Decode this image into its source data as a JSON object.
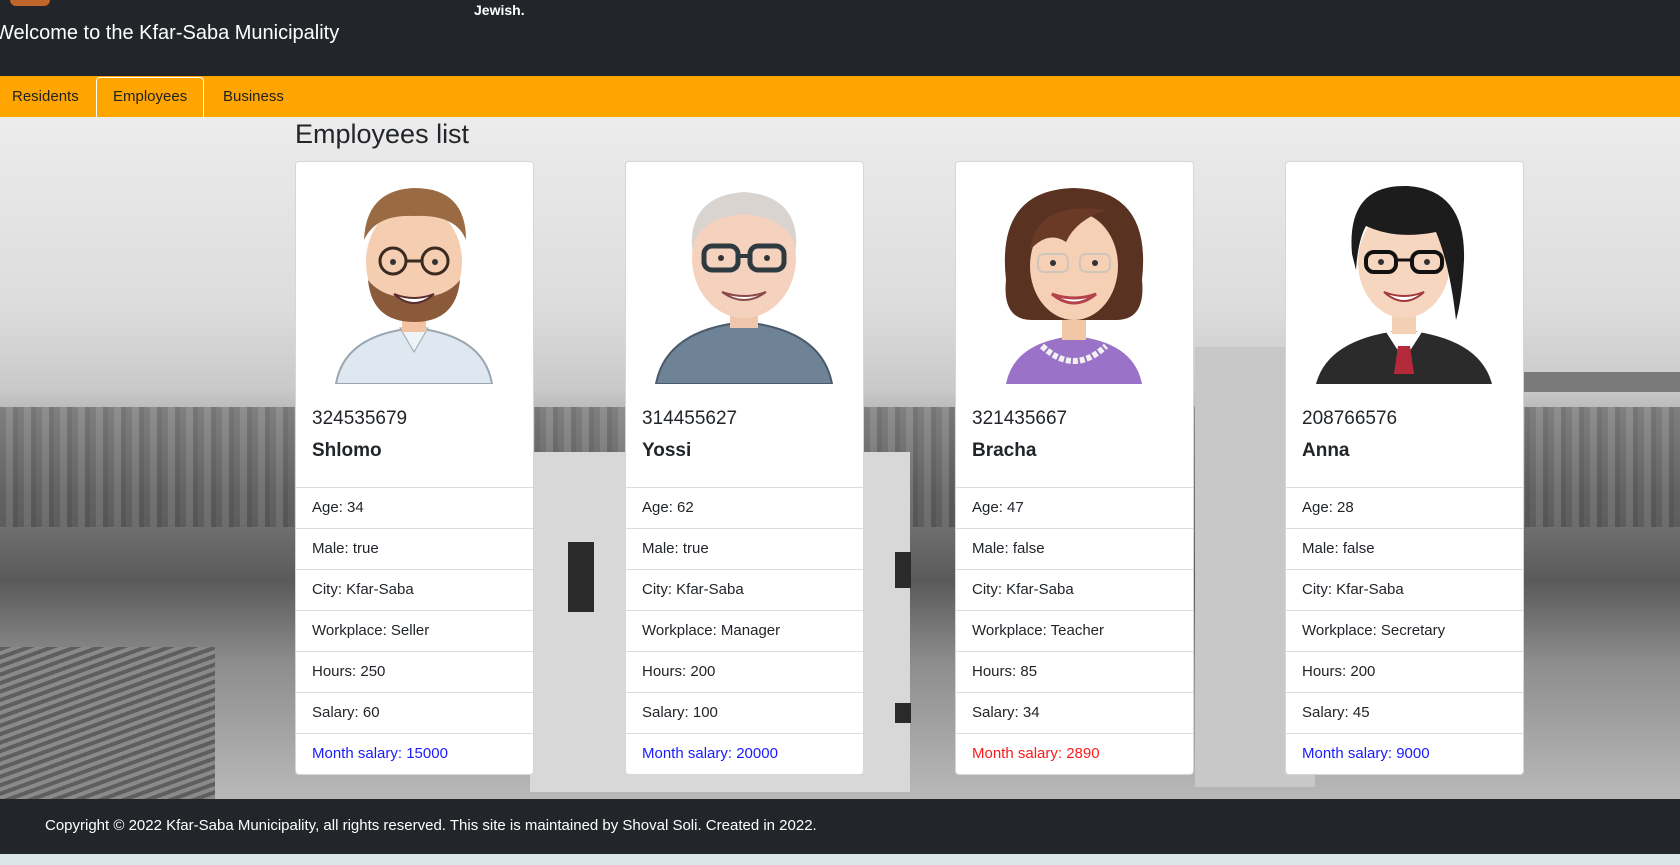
{
  "header": {
    "tagline": "Jewish.",
    "welcome": "Welcome to the Kfar-Saba Municipality"
  },
  "nav": {
    "tabs": [
      {
        "label": "Residents"
      },
      {
        "label": "Employees"
      },
      {
        "label": "Business"
      }
    ],
    "active": "Employees"
  },
  "main": {
    "title": "Employees list"
  },
  "employees": [
    {
      "id": "324535679",
      "name": "Shlomo",
      "age": "Age: 34",
      "male": "Male: true",
      "city": "City: Kfar-Saba",
      "workplace": "Workplace: Seller",
      "hours": "Hours: 250",
      "salary": "Salary: 60",
      "month_salary": "Month salary: 15000",
      "month_color": "#1a1aff"
    },
    {
      "id": "314455627",
      "name": "Yossi",
      "age": "Age: 62",
      "male": "Male: true",
      "city": "City: Kfar-Saba",
      "workplace": "Workplace: Manager",
      "hours": "Hours: 200",
      "salary": "Salary: 100",
      "month_salary": "Month salary: 20000",
      "month_color": "#1a1aff"
    },
    {
      "id": "321435667",
      "name": "Bracha",
      "age": "Age: 47",
      "male": "Male: false",
      "city": "City: Kfar-Saba",
      "workplace": "Workplace: Teacher",
      "hours": "Hours: 85",
      "salary": "Salary: 34",
      "month_salary": "Month salary: 2890",
      "month_color": "#ff1a1a"
    },
    {
      "id": "208766576",
      "name": "Anna",
      "age": "Age: 28",
      "male": "Male: false",
      "city": "City: Kfar-Saba",
      "workplace": "Workplace: Secretary",
      "hours": "Hours: 200",
      "salary": "Salary: 45",
      "month_salary": "Month salary: 9000",
      "month_color": "#1a1aff"
    }
  ],
  "footer": {
    "text": "Copyright © 2022 Kfar-Saba Municipality, all rights reserved. This site is maintained by Shoval Soli. Created in 2022."
  },
  "colors": {
    "header_bg": "#222529",
    "nav_bg": "#ffa500",
    "link_blue": "#1a1aff",
    "alert_red": "#ff1a1a"
  }
}
